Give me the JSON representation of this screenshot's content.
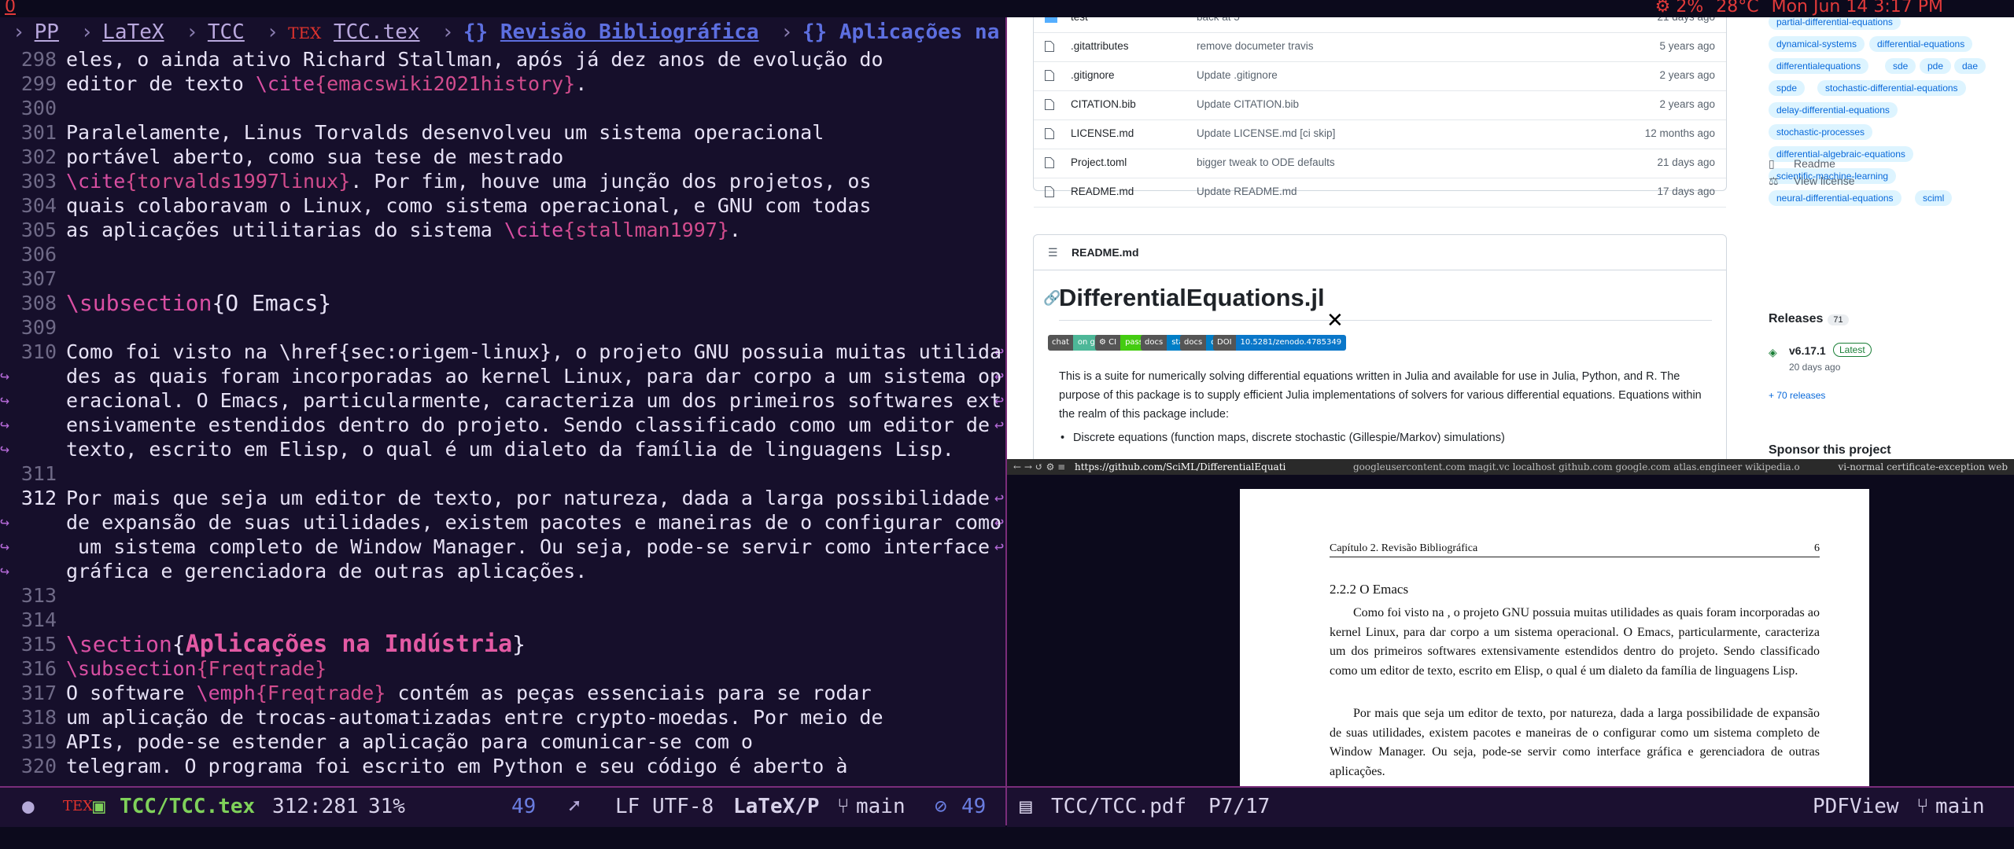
{
  "topbar": {
    "workspace": "0",
    "cpu": "2%",
    "temp": "28°C",
    "datetime": "Mon Jun 14  3:17 PM"
  },
  "editor": {
    "breadcrumb": {
      "pp": "PP",
      "latex": "LaTeX",
      "tcc": "TCC",
      "tex_icon": "TEX",
      "file": "TCC.tex",
      "section1": "Revisão Bibliográfica",
      "section2": "Aplicações na Indú"
    },
    "lines": [
      {
        "n": "298",
        "t": "eles, o ainda ativo Richard Stallman, após já dez anos de evolução do"
      },
      {
        "n": "299",
        "a": "editor de texto ",
        "c": "\\cite",
        "b": "{emacswiki2021history}",
        "e": "."
      },
      {
        "n": "300",
        "t": ""
      },
      {
        "n": "301",
        "t": "Paralelamente, Linus Torvalds desenvolveu um sistema operacional"
      },
      {
        "n": "302",
        "t": "portável aberto, como sua tese de mestrado"
      },
      {
        "n": "303",
        "c": "\\cite",
        "b": "{torvalds1997linux}",
        "e": ". Por fim, houve uma junção dos projetos, os"
      },
      {
        "n": "304",
        "t": "quais colaboravam o Linux, como sistema operacional, e GNU com todas"
      },
      {
        "n": "305",
        "a": "as aplicações utilitarias do sistema ",
        "c": "\\cite",
        "b": "{stallman1997}",
        "e": "."
      },
      {
        "n": "306",
        "t": ""
      },
      {
        "n": "307",
        "t": ""
      },
      {
        "n": "308",
        "sub_cmd": "\\subsection",
        "sub_arg": "{O Emacs}"
      },
      {
        "n": "309",
        "t": ""
      },
      {
        "n": "310",
        "t": "Como foi visto na \\href{sec:origem-linux}, o projeto GNU possuia muitas utilida"
      },
      {
        "n": "",
        "t": "des as quais foram incorporadas ao kernel Linux, para dar corpo a um sistema op"
      },
      {
        "n": "",
        "t": "eracional. O Emacs, particularmente, caracteriza um dos primeiros softwares ext"
      },
      {
        "n": "",
        "t": "ensivamente estendidos dentro do projeto. Sendo classificado como um editor de"
      },
      {
        "n": "",
        "t": "texto, escrito em Elisp, o qual é um dialeto da família de linguagens Lisp."
      },
      {
        "n": "311",
        "t": ""
      },
      {
        "n": "312",
        "t": "Por mais que seja um editor de texto, por natureza, dada a larga possibilidade"
      },
      {
        "n": "",
        "t": "de expansão de suas utilidades, existem pacotes e maneiras de o configurar como"
      },
      {
        "n": "",
        "t": " um sistema completo de Window Manager. Ou seja, pode-se servir como interface"
      },
      {
        "n": "",
        "t": "gráfica e gerenciadora de outras aplicações."
      },
      {
        "n": "313",
        "t": ""
      },
      {
        "n": "314",
        "t": ""
      },
      {
        "n": "315",
        "sec_cmd": "\\section",
        "sec_arg": "Aplicações na Indústria"
      },
      {
        "n": "316",
        "c": "\\subsection",
        "b": "{Freqtrade}",
        "e": ""
      },
      {
        "n": "317",
        "a": "O software ",
        "c": "\\emph",
        "b": "{Freqtrade}",
        "e": " contém as peças essenciais para se rodar"
      },
      {
        "n": "318",
        "t": "um aplicação de trocas-automatizadas entre crypto-moedas. Por meio de"
      },
      {
        "n": "319",
        "t": "APIs, pode-se estender a aplicação para comunicar-se com o"
      },
      {
        "n": "320",
        "t": "telegram. O programa foi escrito em Python e seu código é aberto à"
      }
    ],
    "modeline": {
      "dot": "●",
      "tex_icon": "TEX",
      "file": "TCC/TCC.tex",
      "pos": "312:281",
      "pct": "31%",
      "col_count": "49",
      "encoding": "LF UTF-8",
      "mode": "LaTeX/P",
      "branch": "main",
      "errors": "49"
    }
  },
  "browser": {
    "files": [
      {
        "name": "test",
        "msg": "back at 5",
        "age": "21 days ago",
        "type": "dir"
      },
      {
        "name": ".gitattributes",
        "msg": "remove documeter travis",
        "age": "5 years ago",
        "type": "file"
      },
      {
        "name": ".gitignore",
        "msg": "Update .gitignore",
        "age": "2 years ago",
        "type": "file"
      },
      {
        "name": "CITATION.bib",
        "msg": "Update CITATION.bib",
        "age": "2 years ago",
        "type": "file"
      },
      {
        "name": "LICENSE.md",
        "msg": "Update LICENSE.md [ci skip]",
        "age": "12 months ago",
        "type": "file"
      },
      {
        "name": "Project.toml",
        "msg": "bigger tweak to ODE defaults",
        "age": "21 days ago",
        "type": "file"
      },
      {
        "name": "README.md",
        "msg": "Update README.md",
        "age": "17 days ago",
        "type": "file"
      }
    ],
    "readme": {
      "header": "README.md",
      "title": "DifferentialEquations.jl",
      "badges": [
        {
          "l": "chat",
          "r": "on gitter",
          "color": "#4db798"
        },
        {
          "l": "⚙ CI",
          "r": "passing",
          "color": "#44cc11"
        },
        {
          "l": "docs",
          "r": "stable",
          "color": "#007ec6"
        },
        {
          "l": "docs",
          "r": "dev",
          "color": "#007ec6"
        },
        {
          "l": "DOI",
          "r": "10.5281/zenodo.4785349",
          "color": "#0a77c9"
        }
      ],
      "paragraph": "This is a suite for numerically solving differential equations written in Julia and available for use in Julia, Python, and R. The purpose of this package is to supply efficient Julia implementations of solvers for various differential equations. Equations within the realm of this package include:",
      "bullet": "Discrete equations (function maps, discrete stochastic (Gillespie/Markov) simulations)"
    },
    "topics": [
      "partial-differential-equations",
      "dynamical-systems",
      "differential-equations",
      "differentialequations",
      "sde",
      "pde",
      "dae",
      "spde",
      "stochastic-differential-equations",
      "delay-differential-equations",
      "stochastic-processes",
      "differential-algebraic-equations",
      "scientific-machine-learning",
      "neural-differential-equations",
      "sciml"
    ],
    "sidebar": {
      "readme": "Readme",
      "license": "View license",
      "releases": "Releases",
      "release_count": "71",
      "version": "v6.17.1",
      "latest": "Latest",
      "release_date": "20 days ago",
      "more_releases": "+ 70 releases",
      "sponsor": "Sponsor this project"
    },
    "status": {
      "nav": "← → ↺ ⚙ ≡",
      "url": "https://github.com/SciML/DifferentialEquati",
      "tabs": "googleusercontent.com   magit.vc   localhost   github.com   google.com   atlas.engineer   wikipedia.o",
      "mode": "vi-normal certificate-exception web"
    }
  },
  "pdf": {
    "chapter": "Capítulo 2.  Revisão Bibliográfica",
    "page_num": "6",
    "subsection": "2.2.2    O Emacs",
    "para1": "Como foi visto na , o projeto GNU possuia muitas utilidades as quais foram incorporadas ao kernel Linux, para dar corpo a um sistema operacional. O Emacs, particularmente, caracteriza um dos primeiros softwares extensivamente estendidos dentro do projeto. Sendo classificado como um editor de texto, escrito em Elisp, o qual é um dialeto da família de linguagens Lisp.",
    "para2": "Por mais que seja um editor de texto, por natureza, dada a larga possibilidade de expansão de suas utilidades, existem pacotes e maneiras de o configurar como um sistema completo de Window Manager. Ou seja, pode-se servir como interface gráfica e gerenciadora de outras aplicações.",
    "modeline": {
      "file": "TCC/TCC.pdf",
      "page": "P7/17",
      "mode": "PDFView",
      "branch": "main"
    }
  }
}
